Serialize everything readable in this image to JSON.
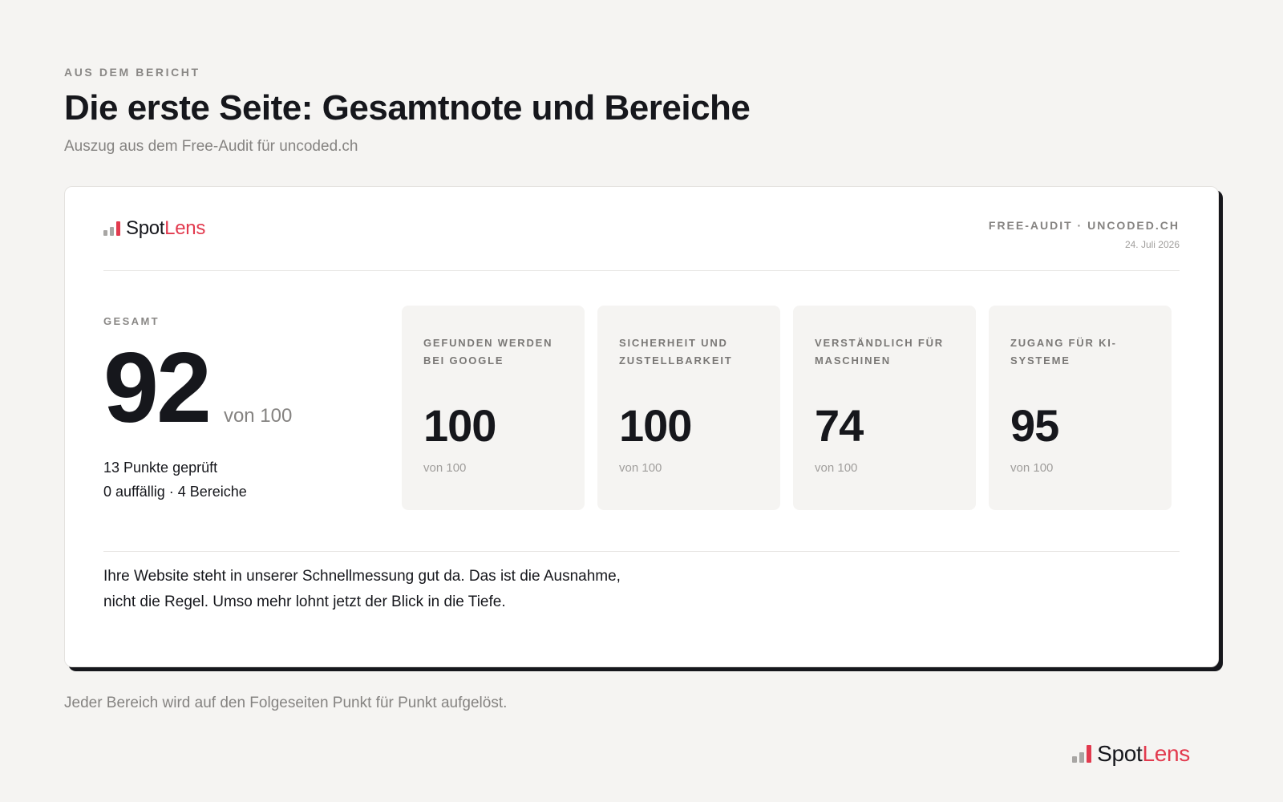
{
  "header": {
    "eyebrow": "AUS DEM BERICHT",
    "title": "Die erste Seite: Gesamtnote und Bereiche",
    "subtitle": "Auszug aus dem Free-Audit für uncoded.ch"
  },
  "brand": {
    "spot": "Spot",
    "lens": "Lens",
    "accent_color": "#e23a4e",
    "bar_color": "#a8a6a4"
  },
  "card": {
    "audit_label": "FREE-AUDIT · UNCODED.CH",
    "audit_date": "24. Juli 2026",
    "total": {
      "label": "GESAMT",
      "score": "92",
      "out_of": "von 100",
      "checked": "13 Punkte geprüft",
      "findings": "0 auffällig · 4 Bereiche"
    },
    "categories": [
      {
        "label": "Gefunden werden bei Google",
        "score": "100",
        "out_of": "von 100"
      },
      {
        "label": "Sicherheit und Zustellbarkeit",
        "score": "100",
        "out_of": "von 100"
      },
      {
        "label": "Verständlich für Maschinen",
        "score": "74",
        "out_of": "von 100"
      },
      {
        "label": "Zugang für KI-Systeme",
        "score": "95",
        "out_of": "von 100"
      }
    ],
    "summary_line1": "Ihre Website steht in unserer Schnellmessung gut da. Das ist die Ausnahme,",
    "summary_line2": "nicht die Regel. Umso mehr lohnt jetzt der Blick in die Tiefe."
  },
  "footer": {
    "note": "Jeder Bereich wird auf den Folgeseiten Punkt für Punkt aufgelöst."
  }
}
